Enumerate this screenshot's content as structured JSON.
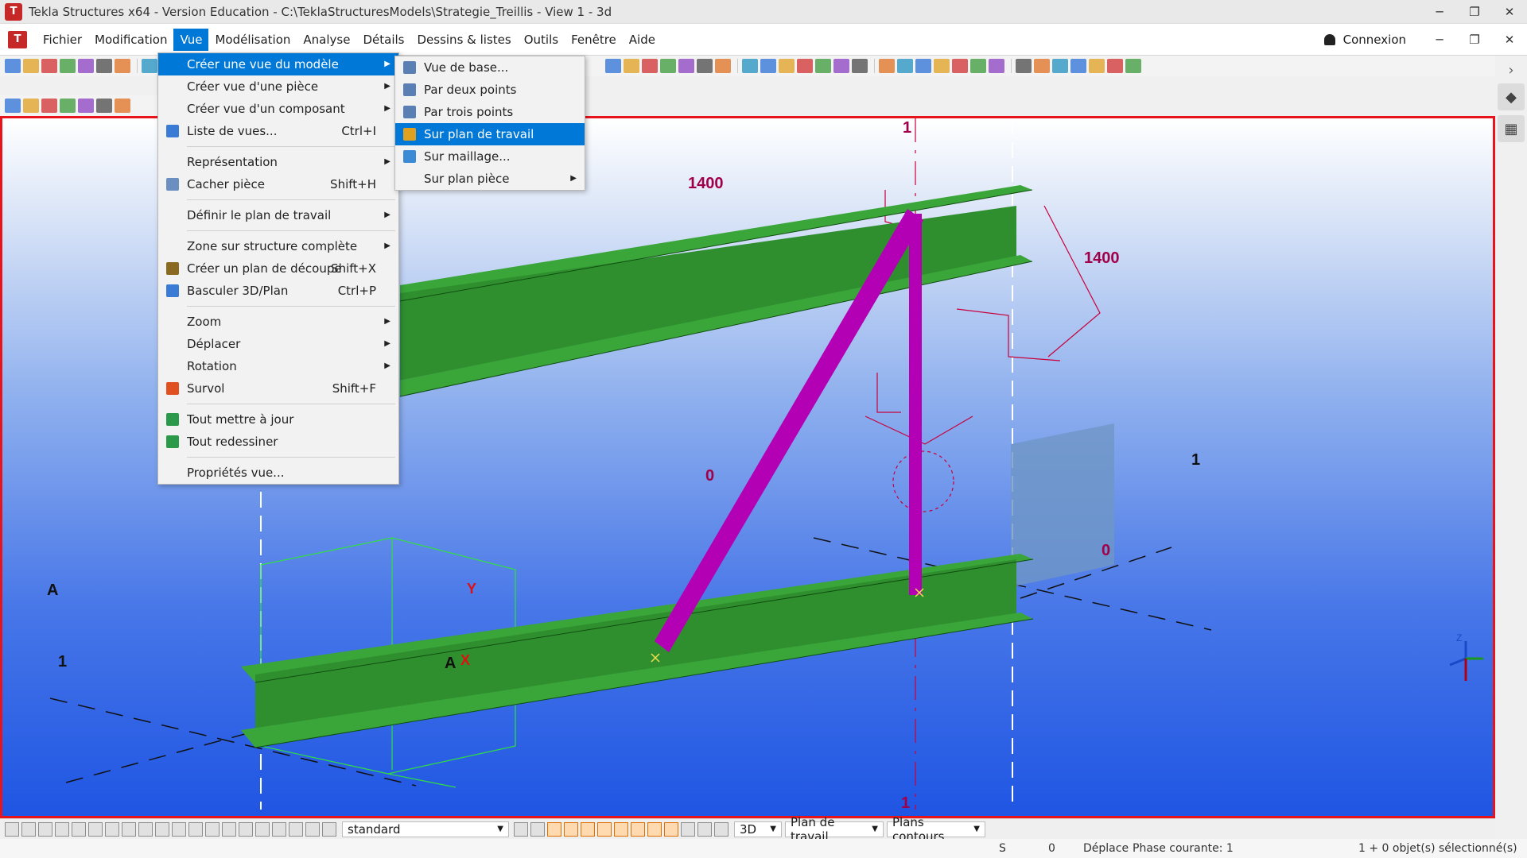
{
  "title_bar": {
    "title": "Tekla Structures x64 - Version Education - C:\\TeklaStructuresModels\\Strategie_Treillis  - View 1 - 3d",
    "minimize": "─",
    "maximize": "❐",
    "close": "✕"
  },
  "menu_bar": {
    "items": [
      "Fichier",
      "Modification",
      "Vue",
      "Modélisation",
      "Analyse",
      "Détails",
      "Dessins & listes",
      "Outils",
      "Fenêtre",
      "Aide"
    ],
    "active_item": "Vue",
    "login_label": "Connexion",
    "minimize": "─",
    "restore": "❐",
    "close": "✕"
  },
  "vue_menu": {
    "items": [
      {
        "label": "Créer une vue du modèle",
        "shortcut": "",
        "submenu": true,
        "highlighted": true,
        "icon": ""
      },
      {
        "label": "Créer vue d'une pièce",
        "shortcut": "",
        "submenu": true,
        "icon": ""
      },
      {
        "label": "Créer vue d'un composant",
        "shortcut": "",
        "submenu": true,
        "icon": ""
      },
      {
        "label": "Liste de vues...",
        "shortcut": "Ctrl+I",
        "submenu": false,
        "icon": "view-list-icon"
      },
      {
        "label": "Représentation",
        "shortcut": "",
        "submenu": true,
        "icon": ""
      },
      {
        "label": "Cacher pièce",
        "shortcut": "Shift+H",
        "submenu": false,
        "icon": "hide-part-icon"
      },
      {
        "label": "Définir le plan de travail",
        "shortcut": "",
        "submenu": true,
        "icon": ""
      },
      {
        "label": "Zone sur structure complète",
        "shortcut": "",
        "submenu": true,
        "icon": ""
      },
      {
        "label": "Créer un plan de découpe",
        "shortcut": "Shift+X",
        "submenu": false,
        "icon": "clip-plane-icon"
      },
      {
        "label": "Basculer 3D/Plan",
        "shortcut": "Ctrl+P",
        "submenu": false,
        "icon": "toggle-3d-icon"
      },
      {
        "label": "Zoom",
        "shortcut": "",
        "submenu": true,
        "icon": ""
      },
      {
        "label": "Déplacer",
        "shortcut": "",
        "submenu": true,
        "icon": ""
      },
      {
        "label": "Rotation",
        "shortcut": "",
        "submenu": true,
        "icon": ""
      },
      {
        "label": "Survol",
        "shortcut": "Shift+F",
        "submenu": false,
        "icon": "fly-icon"
      },
      {
        "label": "Tout mettre à jour",
        "shortcut": "",
        "submenu": false,
        "icon": "update-all-icon"
      },
      {
        "label": "Tout redessiner",
        "shortcut": "",
        "submenu": false,
        "icon": "redraw-all-icon"
      },
      {
        "label": "Propriétés vue...",
        "shortcut": "",
        "submenu": false,
        "icon": ""
      }
    ],
    "arrow_glyph": "▶"
  },
  "create_view_submenu": {
    "items": [
      {
        "label": "Vue de base...",
        "icon": "basic-view-icon"
      },
      {
        "label": "Par deux points",
        "icon": "two-points-icon"
      },
      {
        "label": "Par trois points",
        "icon": "three-points-icon"
      },
      {
        "label": "Sur plan de travail",
        "icon": "work-plane-icon",
        "highlighted": true
      },
      {
        "label": "Sur maillage...",
        "icon": "grid-icon"
      },
      {
        "label": "Sur plan pièce",
        "icon": "",
        "submenu": true
      }
    ]
  },
  "viewport": {
    "labels": {
      "grid_top_1": "1",
      "dim_1400_left": "1400",
      "dim_1400_right": "1400",
      "grid_right_1": "1",
      "zero_left": "0",
      "zero_right": "0",
      "grid_a_left": "A",
      "grid_1_left": "1",
      "grid_a_bottom": "A",
      "grid_bottom_1": "1",
      "axis_y": "Y",
      "axis_x": "X",
      "coord_z": "Z"
    },
    "colors": {
      "beam": "#3aa63a",
      "beam_dark": "#1f6e1f",
      "diagonal": "#b400b4",
      "dimension": "#b0004a",
      "frame": "#e8141c"
    }
  },
  "bottom_bar": {
    "filter_value": "standard",
    "view_mode": "3D",
    "plane_value": "Plan de travail",
    "snap_value": "Plans contours"
  },
  "status_bar": {
    "field_s": "S",
    "field_zero": "0",
    "field_move": "Déplace",
    "phase": "Phase courante: 1",
    "selection": "1 + 0 objet(s) sélectionné(s)"
  }
}
